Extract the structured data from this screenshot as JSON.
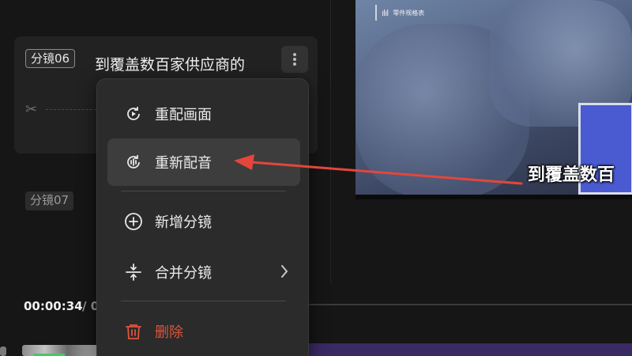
{
  "scenes": [
    {
      "tag": "分镜06",
      "text": "到覆盖数百家供应商的"
    },
    {
      "tag": "分镜07"
    }
  ],
  "timeline": {
    "current_time": "00:00:34",
    "separator": "/ 0"
  },
  "preview": {
    "logo_text": "零件规格表",
    "subtitle": "到覆盖数百"
  },
  "context_menu": {
    "items": [
      {
        "label": "重配画面",
        "icon": "redraw-scene-icon"
      },
      {
        "label": "重新配音",
        "icon": "redub-audio-icon"
      },
      {
        "label": "新增分镜",
        "icon": "add-circle-icon"
      },
      {
        "label": "合并分镜",
        "icon": "merge-icon"
      },
      {
        "label": "删除",
        "icon": "trash-icon"
      }
    ]
  },
  "colors": {
    "accent_red": "#e0533a",
    "arrow_red": "#e4463b",
    "menu_bg": "#2b2b2b",
    "hover_bg": "#3d3d3d"
  }
}
